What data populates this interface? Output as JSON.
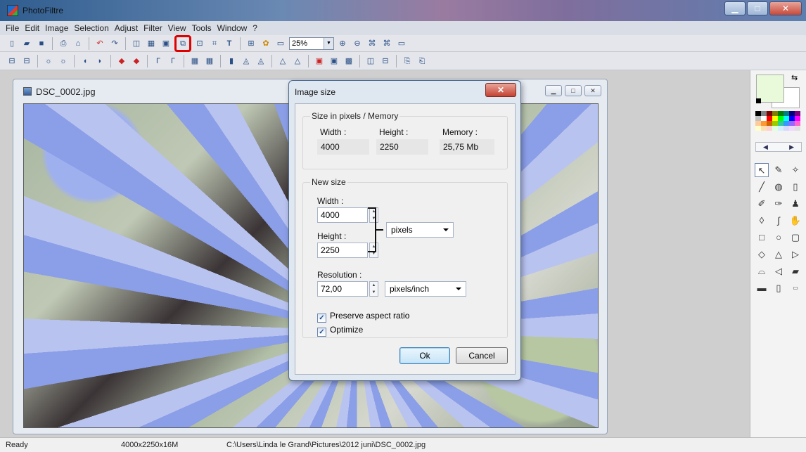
{
  "app": {
    "title": "PhotoFiltre"
  },
  "menu": [
    "File",
    "Edit",
    "Image",
    "Selection",
    "Adjust",
    "Filter",
    "View",
    "Tools",
    "Window",
    "?"
  ],
  "toolbar": {
    "zoom_value": "25%"
  },
  "image_window": {
    "title": "DSC_0002.jpg"
  },
  "dialog": {
    "title": "Image size",
    "current_group": "Size in pixels / Memory",
    "width_label": "Width :",
    "height_label": "Height :",
    "memory_label": "Memory :",
    "width_value": "4000",
    "height_value": "2250",
    "memory_value": "25,75 Mb",
    "new_group": "New size",
    "new_width_label": "Width :",
    "new_width_value": "4000",
    "new_height_label": "Height :",
    "new_height_value": "2250",
    "unit_value": "pixels",
    "resolution_label": "Resolution :",
    "resolution_value": "72,00",
    "resolution_unit": "pixels/inch",
    "preserve_label": "Preserve aspect ratio",
    "preserve_checked": true,
    "optimize_label": "Optimize",
    "optimize_checked": true,
    "ok_label": "Ok",
    "cancel_label": "Cancel"
  },
  "status": {
    "state": "Ready",
    "info": "4000x2250x16M",
    "path": "C:\\Users\\Linda le Grand\\Pictures\\2012 juni\\DSC_0002.jpg"
  },
  "colors": {
    "foreground": "#e8fad9",
    "background": "#ffffff",
    "highlight": "#e00000"
  },
  "palette": [
    "#000000",
    "#808080",
    "#800000",
    "#808000",
    "#008000",
    "#008080",
    "#000080",
    "#800080",
    "#c0c0c0",
    "#ffffff",
    "#ff0000",
    "#ffff00",
    "#00ff00",
    "#00ffff",
    "#0000ff",
    "#ff00ff",
    "#ffcc99",
    "#ff9933",
    "#cc6600",
    "#99cc00",
    "#33cc99",
    "#3399ff",
    "#9966ff",
    "#ff66cc",
    "#ffffcc",
    "#ffe0b0",
    "#ffd0d0",
    "#e0ffe0",
    "#d0f0ff",
    "#d8d8ff",
    "#f0d8ff",
    "#e0e0e0"
  ]
}
